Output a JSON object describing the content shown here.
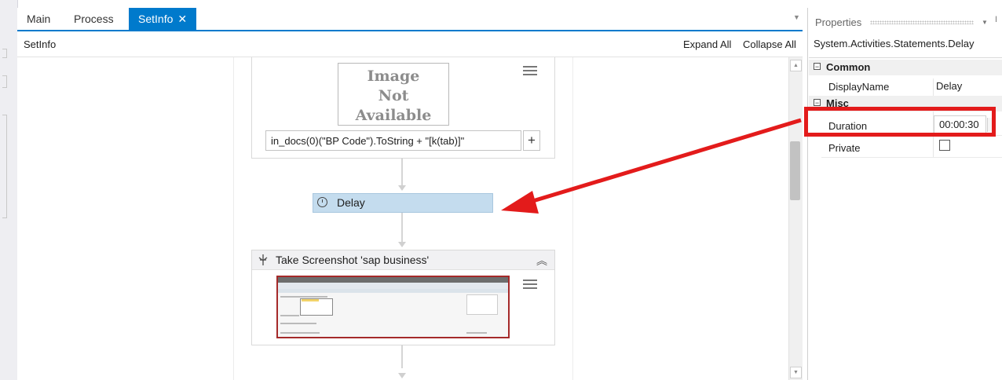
{
  "tabs": [
    {
      "label": "Main",
      "active": false
    },
    {
      "label": "Process",
      "active": false
    },
    {
      "label": "SetInfo",
      "active": true,
      "close_icon": "✕"
    }
  ],
  "breadcrumb": "SetInfo",
  "toolbar": {
    "expand_all": "Expand All",
    "collapse_all": "Collapse All"
  },
  "workflow": {
    "image_placeholder": [
      "Image",
      "Not",
      "Available"
    ],
    "expression": "in_docs(0)(\"BP Code\").ToString + \"[k(tab)]\"",
    "plus_label": "+",
    "delay_label": "Delay",
    "screenshot_title": "Take Screenshot 'sap business'"
  },
  "properties": {
    "title": "Properties",
    "type_name": "System.Activities.Statements.Delay",
    "categories": [
      {
        "name": "Common",
        "rows": [
          {
            "name": "DisplayName",
            "value": "Delay"
          }
        ]
      },
      {
        "name": "Misc",
        "rows": [
          {
            "name": "Duration",
            "value": "00:00:30"
          },
          {
            "name": "Private",
            "checked": false
          }
        ]
      }
    ]
  },
  "colors": {
    "accent": "#007acc",
    "highlight": "#e31b1b",
    "delay_bg": "#c4dcee"
  },
  "icons": [
    "menu-icon",
    "plus-icon",
    "clock-icon",
    "screenshot-icon",
    "collapse-chevron-icon",
    "close-icon",
    "collapse-box-icon"
  ]
}
